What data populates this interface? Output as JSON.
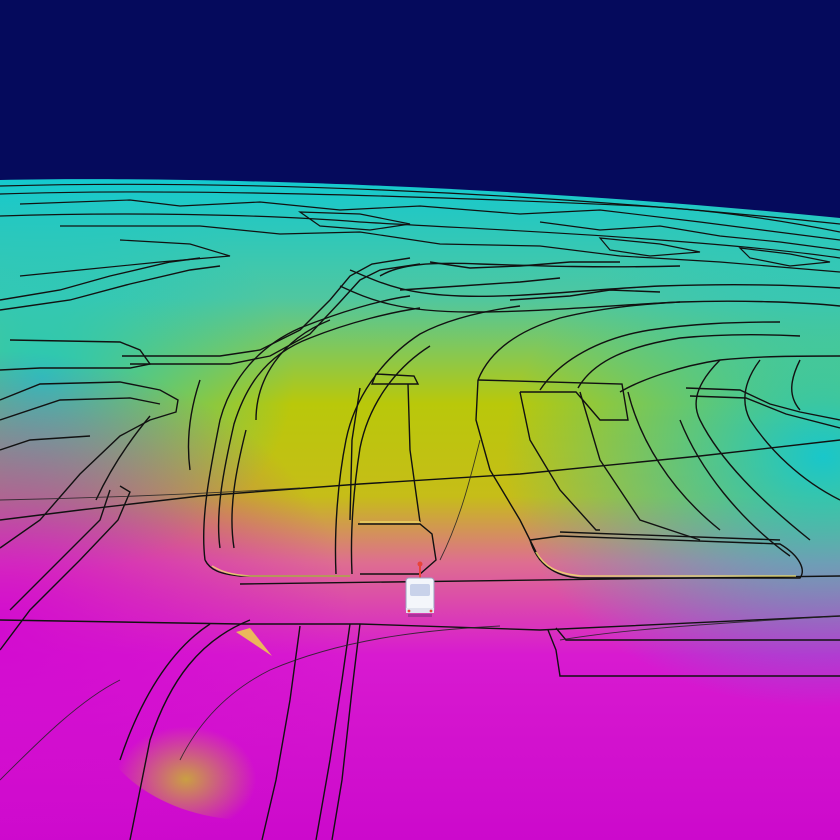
{
  "scene": {
    "description_view": "3d-terrain",
    "colors": {
      "sky": "#050a5c",
      "far_terrain": "#12c4cc",
      "mid_terrain": "#b9c80a",
      "near_terrain": "#d10fd0",
      "transition": "#de6e90",
      "curb_line": "#111111",
      "vehicle_body": "#f4f6fb",
      "vehicle_marker": "#e8443a"
    },
    "elements": {
      "sky": "sky-region",
      "terrain": "terrain-surface",
      "roads": "road-network",
      "vehicle": "ego-vehicle"
    }
  }
}
